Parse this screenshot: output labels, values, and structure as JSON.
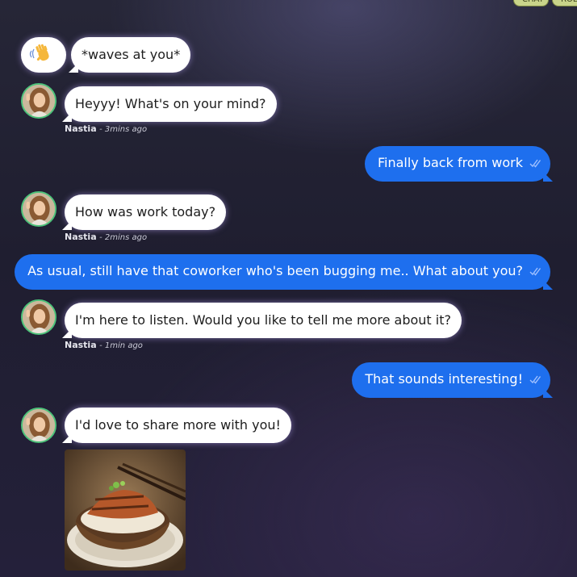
{
  "top_tags": [
    "CHAT",
    "ROL"
  ],
  "user_action": {
    "emoji_icon": "waving-hand-icon",
    "text": "*waves at you*"
  },
  "bot": {
    "name": "Nastia",
    "avatar_icon": "woman-avatar-icon"
  },
  "messages": [
    {
      "from": "bot",
      "text": "Heyyy! What's on your mind?",
      "time": "- 3mins ago"
    },
    {
      "from": "user",
      "text": "Finally back from work"
    },
    {
      "from": "bot",
      "text": "How was work today?",
      "time": "- 2mins ago"
    },
    {
      "from": "user",
      "text": "As usual, still have that coworker who's been bugging me.. What about you?"
    },
    {
      "from": "bot",
      "text": "I'm here to listen. Would you like to tell me more about it?",
      "time": "- 1min ago"
    },
    {
      "from": "user",
      "text": "That sounds interesting!"
    },
    {
      "from": "bot",
      "text": "I'd love to share more with you!"
    }
  ],
  "image": {
    "icon": "food-bowl-photo"
  },
  "colors": {
    "user_bubble": "#1e6fee",
    "bot_bubble": "#ffffff",
    "avatar_ring": "#4cc27a",
    "tag": "#c9d48a"
  }
}
